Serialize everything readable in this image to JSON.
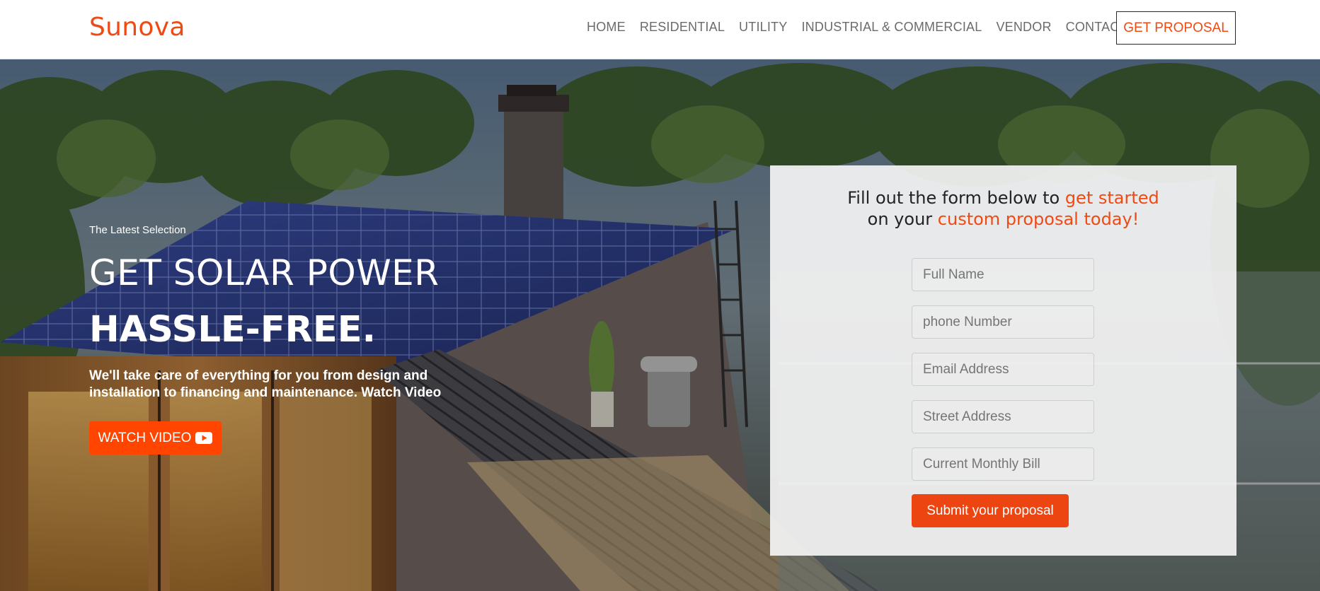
{
  "brand": {
    "name": "Sunova",
    "color": "#f04a14"
  },
  "nav": {
    "items": [
      {
        "label": "HOME"
      },
      {
        "label": "RESIDENTIAL"
      },
      {
        "label": "UTILITY"
      },
      {
        "label": "INDUSTRIAL & COMMERCIAL"
      },
      {
        "label": "VENDOR"
      },
      {
        "label": "CONTACT US"
      }
    ],
    "cta_label": "GET PROPOSAL"
  },
  "hero": {
    "eyebrow": "The Latest Selection",
    "headline_line1": "GET SOLAR POWER",
    "headline_line2": "HASSLE-FREE.",
    "subtext": "We'll take care of everything for you from design and installation to financing and maintenance. Watch Video",
    "watch_button_label": "WATCH VIDEO",
    "watch_button_icon": "youtube-icon",
    "background_image": "solar-panel-house-photo"
  },
  "form": {
    "heading_part1": "Fill out the form below to ",
    "heading_accent1": "get started",
    "heading_part2": "on your ",
    "heading_accent2": "custom proposal today!",
    "fields": [
      {
        "placeholder": "Full Name"
      },
      {
        "placeholder": "phone Number"
      },
      {
        "placeholder": "Email Address"
      },
      {
        "placeholder": "Street Address"
      },
      {
        "placeholder": "Current Monthly Bill"
      }
    ],
    "submit_label": "Submit your proposal"
  },
  "colors": {
    "accent": "#f04a14",
    "button_orange": "#ff4500",
    "nav_text": "#6b6b6b"
  }
}
